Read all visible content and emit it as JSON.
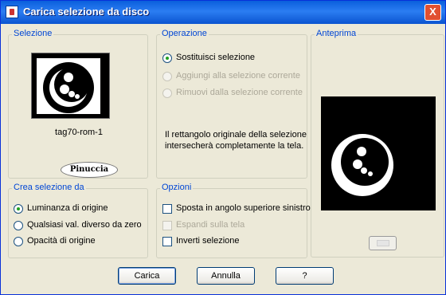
{
  "window": {
    "title": "Carica selezione da disco",
    "close_glyph": "X",
    "icon": "app-icon"
  },
  "selezione": {
    "title": "Selezione",
    "name": "tag70-rom-1",
    "logo_text": "Pinuccia",
    "dropdown_glyph": "▼"
  },
  "operazione": {
    "title": "Operazione",
    "options": [
      {
        "label": "Sostituisci selezione",
        "checked": true,
        "enabled": true
      },
      {
        "label": "Aggiungi alla selezione corrente",
        "checked": false,
        "enabled": false
      },
      {
        "label": "Rimuovi dalla selezione corrente",
        "checked": false,
        "enabled": false
      }
    ],
    "info": "Il rettangolo originale della selezione intersecherà completamente la tela."
  },
  "anteprima": {
    "title": "Anteprima"
  },
  "crea": {
    "title": "Crea selezione da",
    "options": [
      {
        "label": "Luminanza di origine",
        "checked": true
      },
      {
        "label": "Qualsiasi val. diverso da zero",
        "checked": false
      },
      {
        "label": "Opacità di origine",
        "checked": false
      }
    ]
  },
  "opzioni": {
    "title": "Opzioni",
    "items": [
      {
        "label": "Sposta in angolo superiore sinistro",
        "checked": false,
        "enabled": true
      },
      {
        "label": "Espandi sulla tela",
        "checked": false,
        "enabled": false
      },
      {
        "label": "Inverti selezione",
        "checked": false,
        "enabled": true
      }
    ]
  },
  "buttons": {
    "ok": "Carica",
    "cancel": "Annulla",
    "help": "?"
  }
}
